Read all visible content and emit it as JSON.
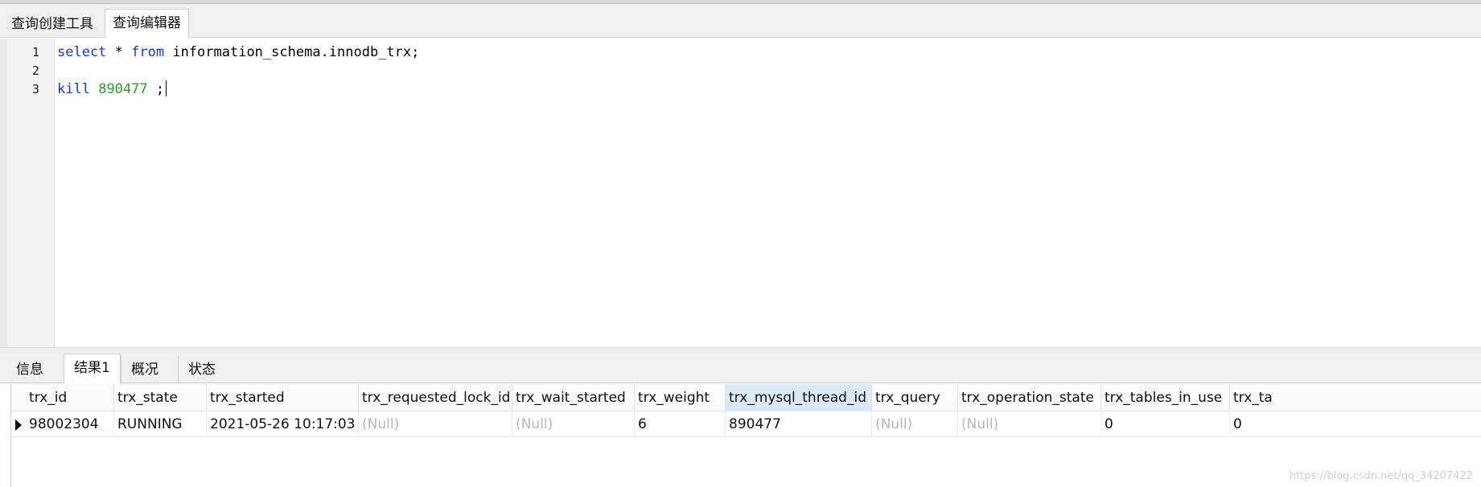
{
  "tabs": [
    {
      "label": "查询创建工具"
    },
    {
      "label": "查询编辑器",
      "active": true
    }
  ],
  "editor": {
    "line_numbers": [
      "1",
      "2",
      "3"
    ],
    "lines": [
      {
        "kw1": "select",
        "rest1": " * ",
        "kw2": "from",
        "rest2": " information_schema.innodb_trx;"
      },
      {},
      {
        "kw1": "kill",
        "num": "890477",
        "rest": " ;"
      }
    ],
    "colors": {
      "keyword": "#1a36d8",
      "number": "#2f9a2f"
    }
  },
  "result_tabs": [
    {
      "label": "信息"
    },
    {
      "label": "结果1",
      "active": true
    },
    {
      "label": "概况"
    },
    {
      "label": "状态"
    }
  ],
  "grid": {
    "columns": [
      "trx_id",
      "trx_state",
      "trx_started",
      "trx_requested_lock_id",
      "trx_wait_started",
      "trx_weight",
      "trx_mysql_thread_id",
      "trx_query",
      "trx_operation_state",
      "trx_tables_in_use",
      "trx_ta"
    ],
    "selected_column": "trx_mysql_thread_id",
    "rows": [
      [
        "98002304",
        "RUNNING",
        "2021-05-26 10:17:03",
        "(Null)",
        "(Null)",
        "6",
        "890477",
        "(Null)",
        "(Null)",
        "0",
        "0"
      ]
    ]
  },
  "watermark": "https://blog.csdn.net/qq_34207422"
}
